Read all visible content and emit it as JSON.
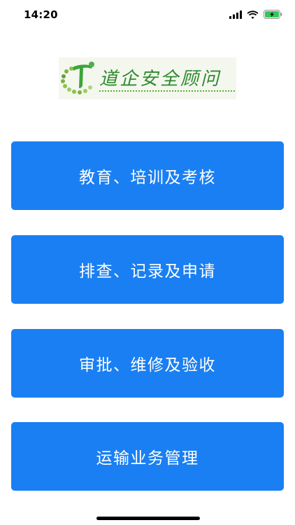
{
  "status_bar": {
    "time": "14:20",
    "icons": [
      "signal-icon",
      "wifi-icon",
      "battery-charging-icon"
    ]
  },
  "logo": {
    "text": "道企安全顾问",
    "icon": "logo-icon"
  },
  "menu": {
    "items": [
      {
        "label": "教育、培训及考核"
      },
      {
        "label": "排查、记录及申请"
      },
      {
        "label": "审批、维修及验收"
      },
      {
        "label": "运输业务管理"
      }
    ]
  },
  "colors": {
    "button_bg": "#1a7ff2",
    "button_text": "#ffffff",
    "logo_green": "#2e8a2e",
    "battery_green": "#34c759"
  }
}
